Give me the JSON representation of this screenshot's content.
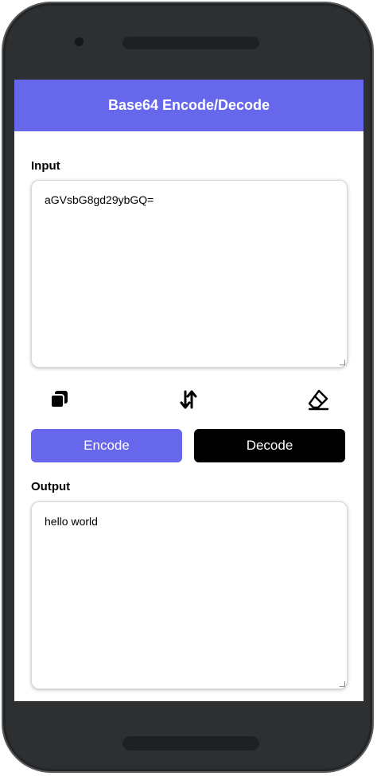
{
  "app": {
    "title": "Base64 Encode/Decode"
  },
  "input": {
    "label": "Input",
    "value": "aGVsbG8gd29ybGQ="
  },
  "toolbar": {
    "copy_icon": "copy-icon",
    "swap_icon": "swap-vertical-icon",
    "clear_icon": "eraser-icon"
  },
  "actions": {
    "encode_label": "Encode",
    "decode_label": "Decode"
  },
  "output": {
    "label": "Output",
    "value": "hello world"
  },
  "colors": {
    "accent": "#6667eb",
    "decode_button": "#000000",
    "phone_frame": "#2d2f31"
  }
}
